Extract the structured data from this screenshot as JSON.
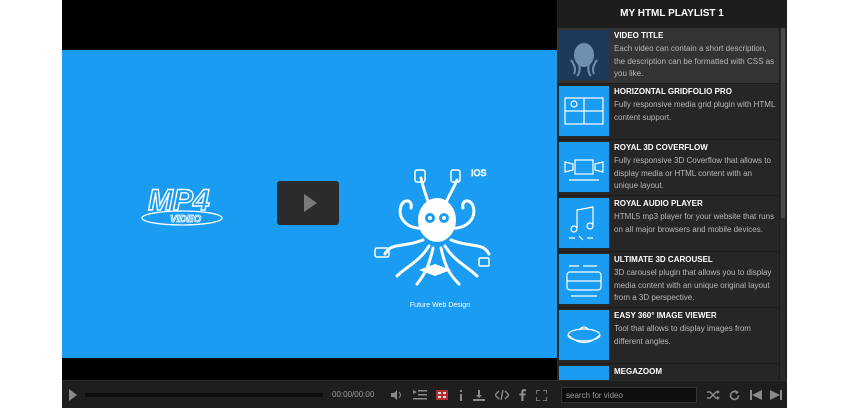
{
  "video": {
    "logo_text": "MP4",
    "logo_sub": "VIDEO",
    "caption": "Future Web Design",
    "octopus_label": "IOS"
  },
  "controls": {
    "time": "00:00/00:00",
    "search_placeholder": "search for video"
  },
  "playlist": {
    "title": "MY HTML PLAYLIST 1",
    "items": [
      {
        "title": "VIDEO TITLE",
        "description": "Each video can contain a short description, the description can be formatted with CSS as you like."
      },
      {
        "title": "HORIZONTAL GRIDFOLIO PRO",
        "description": "Fully responsive media grid plugin with HTML content support."
      },
      {
        "title": "ROYAL 3D COVERFLOW",
        "description": "Fully responsive 3D Coverflow that allows to display media or HTML content with an unique layout."
      },
      {
        "title": "ROYAL AUDIO PLAYER",
        "description": "HTML5 mp3 player for your website that runs on all major browsers and mobile devices."
      },
      {
        "title": "ULTIMATE 3D CAROUSEL",
        "description": "3D carousel plugin that allows you to display media content with an unique original layout from a 3D perspective."
      },
      {
        "title": "EASY 360° IMAGE VIEWER",
        "description": "Tool that allows to display images from different angles."
      },
      {
        "title": "MEGAZOOM",
        "description": ""
      }
    ]
  }
}
